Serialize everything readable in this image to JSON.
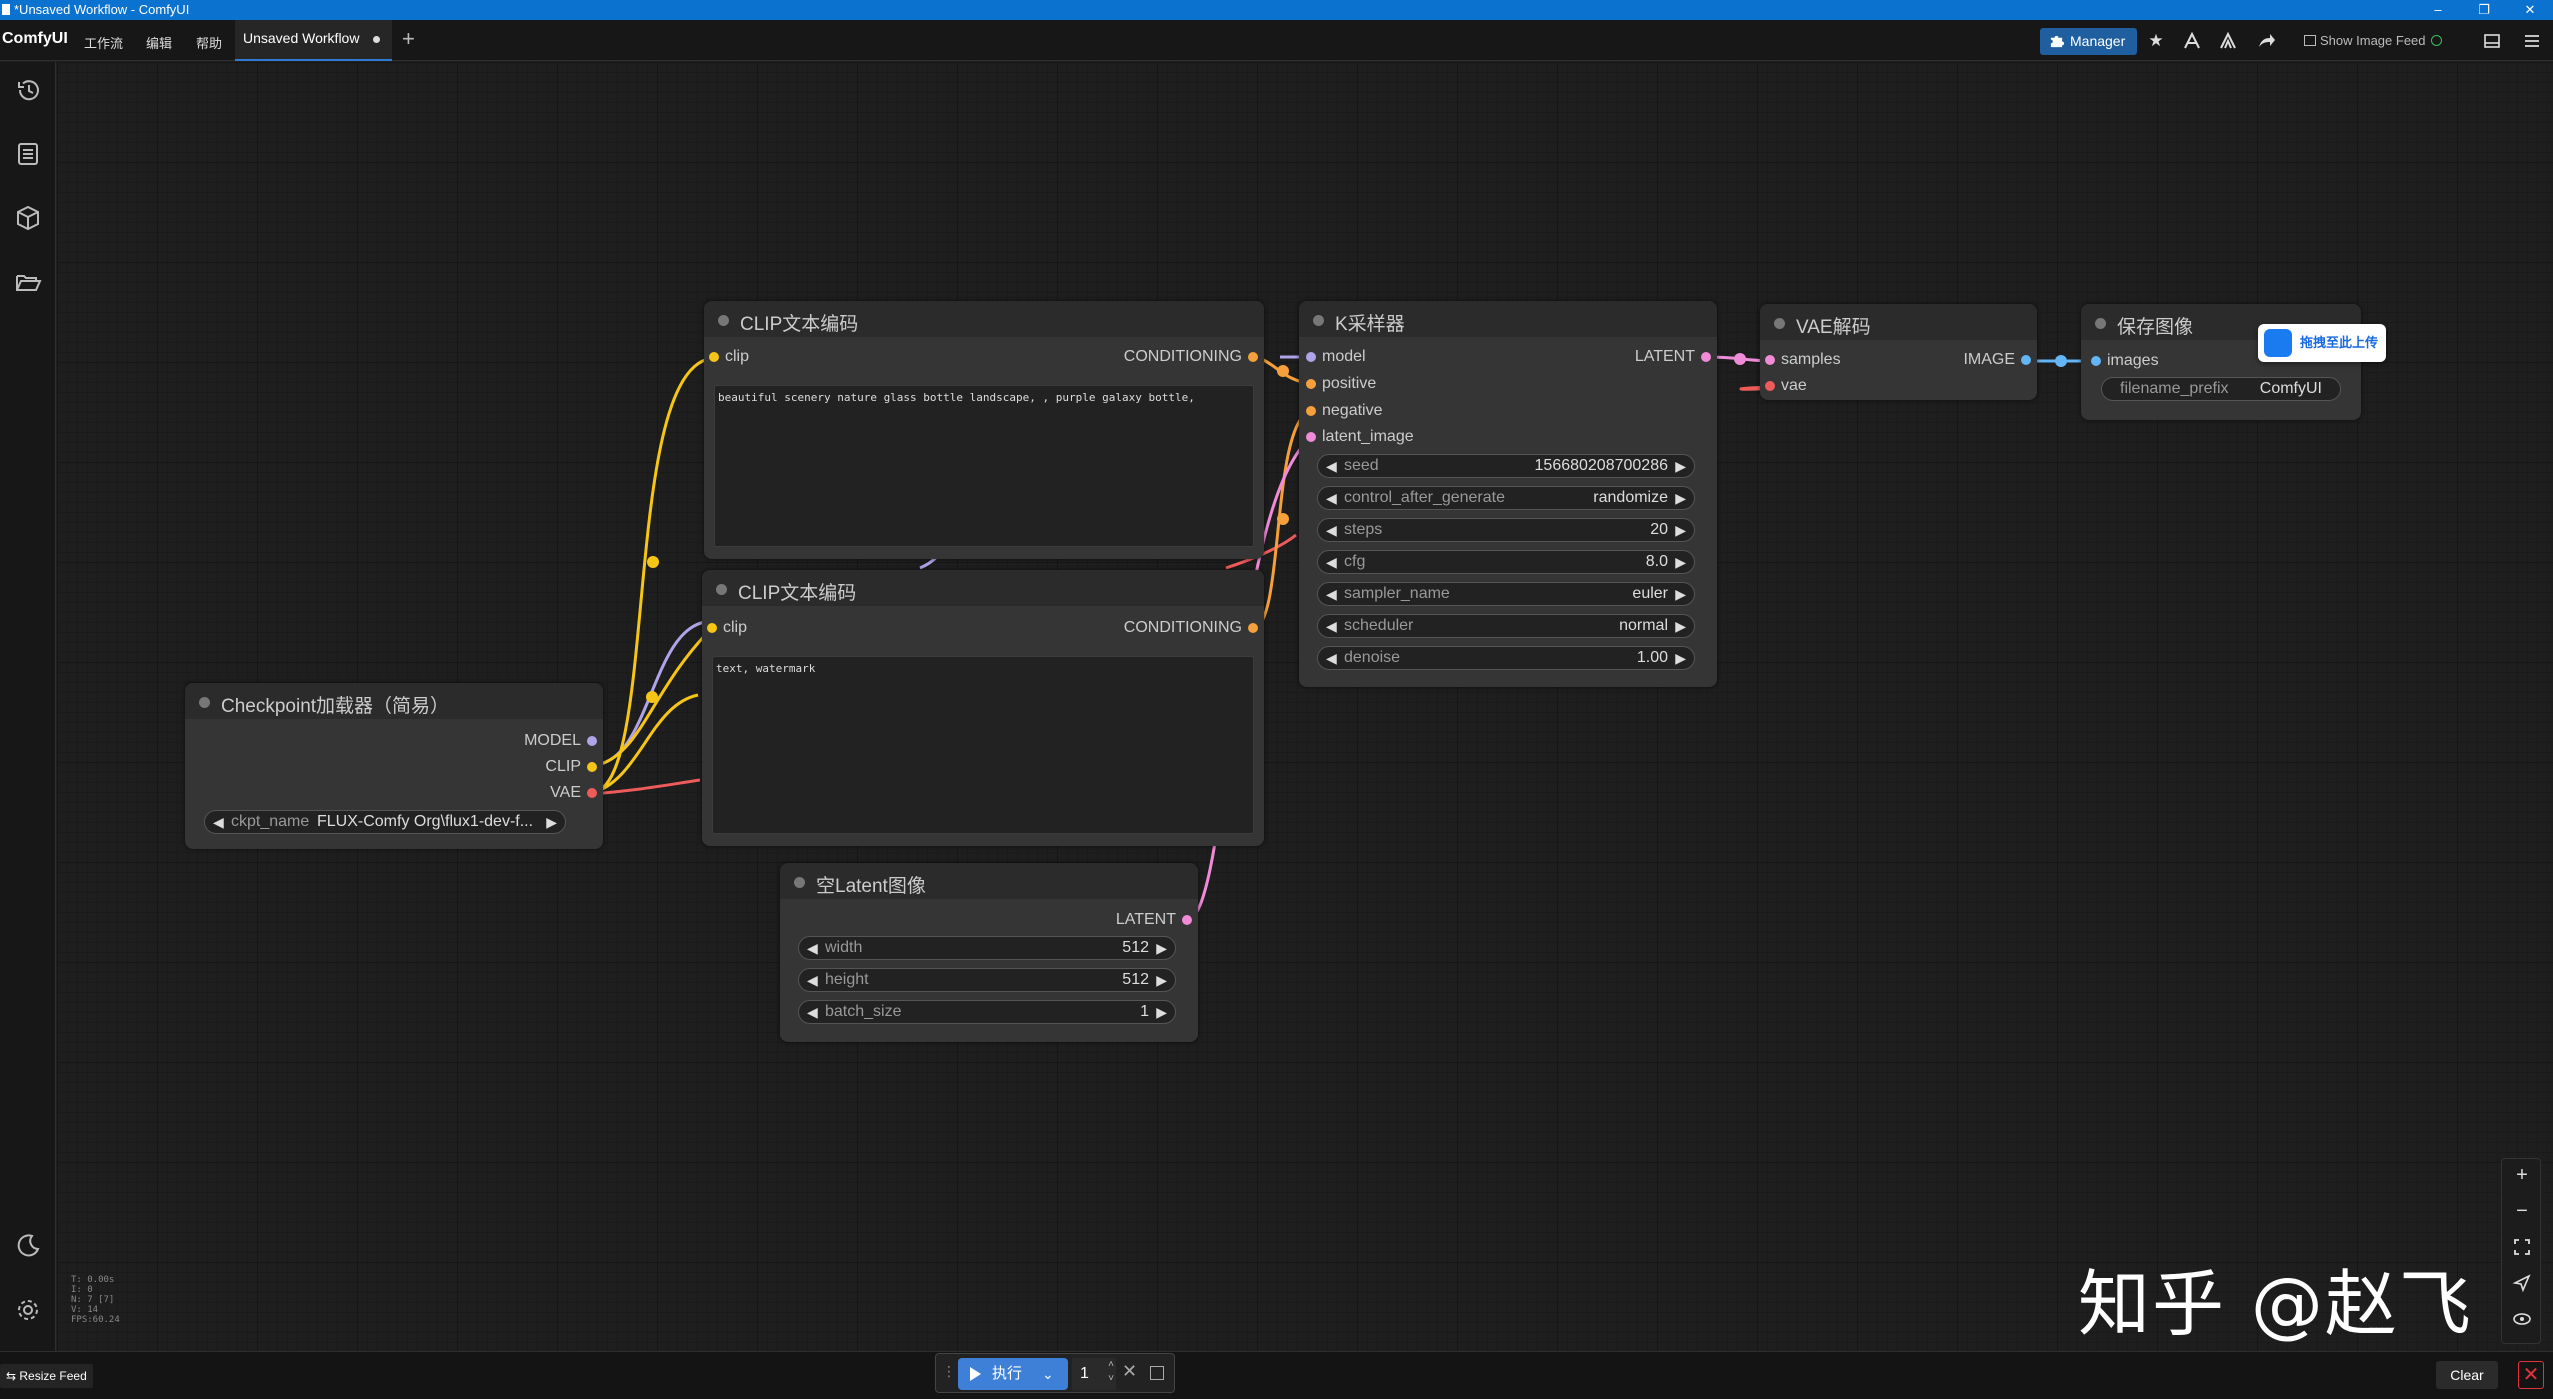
{
  "window": {
    "title": "*Unsaved Workflow - ComfyUI",
    "controls": [
      "–",
      "❐",
      "✕"
    ]
  },
  "menubar": {
    "logo": "ComfyUI",
    "menus": [
      "工作流",
      "编辑",
      "帮助"
    ],
    "active_tab": "Unsaved Workflow",
    "new_tab_symbol": "+",
    "manager_label": "Manager",
    "show_image_feed_label": "Show Image Feed",
    "icons": [
      "star-icon",
      "node-library-icon",
      "model-library-icon",
      "share-icon",
      "panel-toggle-icon",
      "hamburger-menu-icon"
    ]
  },
  "sidebar": {
    "icons": [
      "history-icon",
      "queue-list-icon",
      "model-cube-icon",
      "folder-open-icon",
      "theme-moon-icon",
      "settings-gear-icon"
    ]
  },
  "nodes": {
    "clip_pos": {
      "title": "CLIP文本编码",
      "input": "clip",
      "output": "CONDITIONING",
      "text": "beautiful scenery nature glass bottle landscape, , purple galaxy bottle,"
    },
    "clip_neg": {
      "title": "CLIP文本编码",
      "input": "clip",
      "output": "CONDITIONING",
      "text": "text, watermark"
    },
    "checkpoint": {
      "title": "Checkpoint加载器（简易）",
      "outputs": [
        "MODEL",
        "CLIP",
        "VAE"
      ],
      "widget_name": "ckpt_name",
      "widget_value": "FLUX-Comfy Org\\flux1-dev-f..."
    },
    "latent": {
      "title": "空Latent图像",
      "output": "LATENT",
      "widgets": [
        {
          "name": "width",
          "value": "512"
        },
        {
          "name": "height",
          "value": "512"
        },
        {
          "name": "batch_size",
          "value": "1"
        }
      ]
    },
    "ksampler": {
      "title": "K采样器",
      "inputs": [
        "model",
        "positive",
        "negative",
        "latent_image"
      ],
      "output": "LATENT",
      "widgets": [
        {
          "name": "seed",
          "value": "156680208700286"
        },
        {
          "name": "control_after_generate",
          "value": "randomize"
        },
        {
          "name": "steps",
          "value": "20"
        },
        {
          "name": "cfg",
          "value": "8.0"
        },
        {
          "name": "sampler_name",
          "value": "euler"
        },
        {
          "name": "scheduler",
          "value": "normal"
        },
        {
          "name": "denoise",
          "value": "1.00"
        }
      ]
    },
    "vae_decode": {
      "title": "VAE解码",
      "inputs": [
        "samples",
        "vae"
      ],
      "output": "IMAGE"
    },
    "save_image": {
      "title": "保存图像",
      "input": "images",
      "widget_name": "filename_prefix",
      "widget_value": "ComfyUI"
    }
  },
  "upload_tip": "拖拽至此上传",
  "slot_colors": {
    "clip": "#f5c518",
    "conditioning": "#f5a03a",
    "model": "#b0a4e8",
    "latent": "#f08bd8",
    "vae": "#ef5b5b",
    "image": "#64b5f6"
  },
  "stats": [
    "T: 0.00s",
    "I: 0",
    "N: 7 [7]",
    "V: 14",
    "FPS:60.24"
  ],
  "zoom_controls": [
    "zoom-in-icon",
    "zoom-out-icon",
    "fit-view-icon",
    "select-mode-icon",
    "toggle-links-icon"
  ],
  "watermark": "知乎 @赵飞",
  "bottom": {
    "resize_feed": "Resize Feed",
    "run_label": "执行",
    "batch_count": "1",
    "clear_label": "Clear",
    "close_symbol": "✕"
  }
}
